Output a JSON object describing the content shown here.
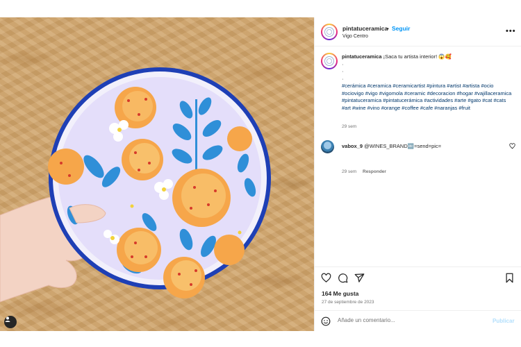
{
  "post": {
    "username": "pintatuceramica",
    "follow_label": "Seguir",
    "separator": "•",
    "location": "Vigo Centro",
    "more_label": "•••",
    "photo_alt": ""
  },
  "caption": {
    "username": "pintatuceramica",
    "text": "¡Saca tu artista interior! 😱🥰",
    "dots": [
      "·",
      "·",
      "·"
    ],
    "hashtags": "#cerámica #ceramica #ceramicartist #pintura #artist #artista #ocio #ociovigo #vigo #vigomola #ceramic #decoracion #hogar #vajillaceramica #pintatuceramica #pintatucerámica #actividades #arte #gato #cat #cats #art #wine #vino #orange #coffee #cafe #naranjas #fruit",
    "time": "29 sem"
  },
  "comment": {
    "username": "vabox_9",
    "text": "@WINES_BRAND🔤=send=pic=",
    "time": "29 sem",
    "reply_label": "Responder"
  },
  "actions": {
    "likes": "164 Me gusta",
    "date": "27 de septiembre de 2023",
    "comment_placeholder": "Añade un comentario...",
    "publish_label": "Publicar"
  },
  "colors": {
    "link": "#0095f6",
    "hashtag": "#00376b",
    "muted": "#737373",
    "publish_disabled": "#b2dffc"
  },
  "icons": [
    "heart-icon",
    "comment-icon",
    "share-icon",
    "bookmark-icon",
    "emoji-icon",
    "user-tag-icon",
    "more-icon"
  ]
}
